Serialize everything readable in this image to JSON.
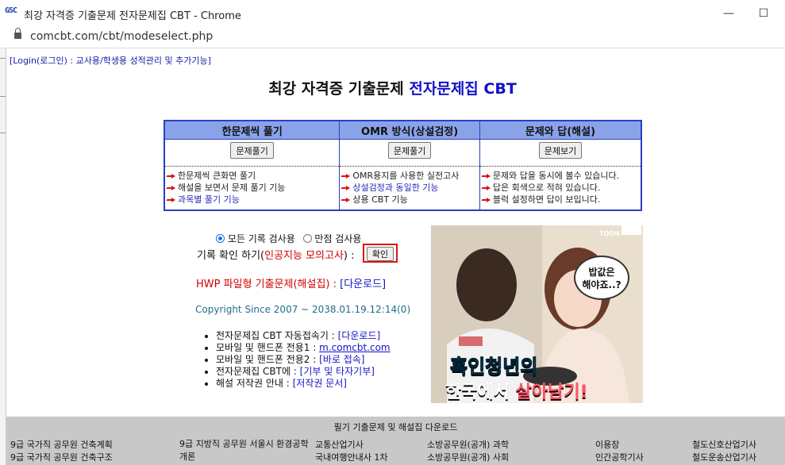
{
  "window": {
    "logo_text": "GSC",
    "title": "최강 자격증 기출문제 전자문제집 CBT - Chrome",
    "minimize": "—",
    "maximize": "☐",
    "url": "comcbt.com/cbt/modeselect.php"
  },
  "header": {
    "login_link": "[Login(로그인) : 교사용/학생용 성적관리 및 추가기능]",
    "title_black": "최강 자격증 기출문제 ",
    "title_blue": "전자문제집 CBT"
  },
  "modes": [
    {
      "header": "한문제씩 풀기",
      "button": "문제풀기",
      "lines": [
        {
          "text": "한문제씩 큰화면 풀기",
          "blue": false
        },
        {
          "text": "해설을 보면서 문제 풀기 기능",
          "blue": false
        },
        {
          "text": "과목별 풀기 기능",
          "blue": true
        }
      ]
    },
    {
      "header": "OMR 방식(상설검정)",
      "button": "문제풀기",
      "lines": [
        {
          "text": "OMR용지를 사용한 실전고사",
          "blue": false
        },
        {
          "text": "상설검정과 동일한 기능",
          "blue": true
        },
        {
          "text": "상용 CBT 기능",
          "blue": false
        }
      ]
    },
    {
      "header": "문제와 답(해설)",
      "button": "문제보기",
      "lines": [
        {
          "text": "문제와 답을 동시에 볼수 있습니다.",
          "blue": false
        },
        {
          "text": "답은 회색으로 적혀 있습니다.",
          "blue": false
        },
        {
          "text": "블럭 설정하면 답이 보입니다.",
          "blue": false
        }
      ]
    }
  ],
  "search": {
    "option_all": "모든 기록 검사용",
    "option_perfect": "만점 검사용",
    "history_label": "기록 확인 하기(",
    "history_red": "인공지능 모의고사",
    "history_end": ") :",
    "confirm_button": "확인"
  },
  "hwp": {
    "text": "HWP 파일형 기출문제(해설집) : ",
    "link": "[다운로드]"
  },
  "copyright": "Copyright Since 2007 ~ 2038.01.19.12:14(0)",
  "links": [
    {
      "label": "전자문제집 CBT 자동접속기 : ",
      "link": "[다운로드]",
      "underline": false
    },
    {
      "label": "모바일 및 핸드폰 전용1 : ",
      "link": "m.comcbt.com",
      "underline": true
    },
    {
      "label": "모바일 및 핸드폰 전용2 : ",
      "link": "[바로 접속]",
      "underline": false
    },
    {
      "label": "전자문제집 CBT에 : ",
      "link": "[기부 및 타자기부]",
      "underline": false
    },
    {
      "label": "해설 저작권 안내 : ",
      "link": "[저작권 문서]",
      "underline": false
    }
  ],
  "ad": {
    "brand": "TOON",
    "bubble": "밥값은\n해야죠..?",
    "line1": "흑인청년의",
    "line2_a": "한국에서 ",
    "line2_b": "살아남기!"
  },
  "footer": {
    "title": "필기 기출문제 및 해설집 다운로드",
    "items": [
      "9급 국가직 공무원 건축계획",
      "9급 국가직 공무원 건축구조",
      "9급 지방직 공무원 서울시 환경공학개론",
      "교통산업기사",
      "국내여행안내사 1차",
      "소방공무원(공개) 과학",
      "소방공무원(공개) 사회",
      "이용장",
      "인간공학기사",
      "철도신호산업기사",
      "철도운송산업기사"
    ]
  }
}
